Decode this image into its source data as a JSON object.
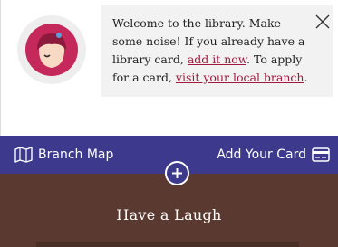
{
  "welcome": {
    "line1": "Welcome to the library. Make",
    "line2": "some noise! If you already have a",
    "line3_prefix": "library card, ",
    "add_link": "add it now",
    "line3_suffix": ". To apply",
    "line4_prefix": "for a card, ",
    "branch_link": "visit your local branch",
    "line4_suffix": "."
  },
  "nav": {
    "branch_map_label": "Branch Map",
    "add_card_label": "Add Your Card"
  },
  "main": {
    "section_title": "Have a Laugh"
  },
  "icons": {
    "close": "close-icon",
    "map": "map-icon",
    "card": "card-icon",
    "plus": "plus-icon",
    "avatar": "libby-avatar-icon"
  },
  "colors": {
    "nav_bg": "#3d3a8e",
    "main_bg": "#5a3a30",
    "link": "#a01a40",
    "avatar_face": "#f7d9c4",
    "avatar_hair": "#c5285a"
  }
}
